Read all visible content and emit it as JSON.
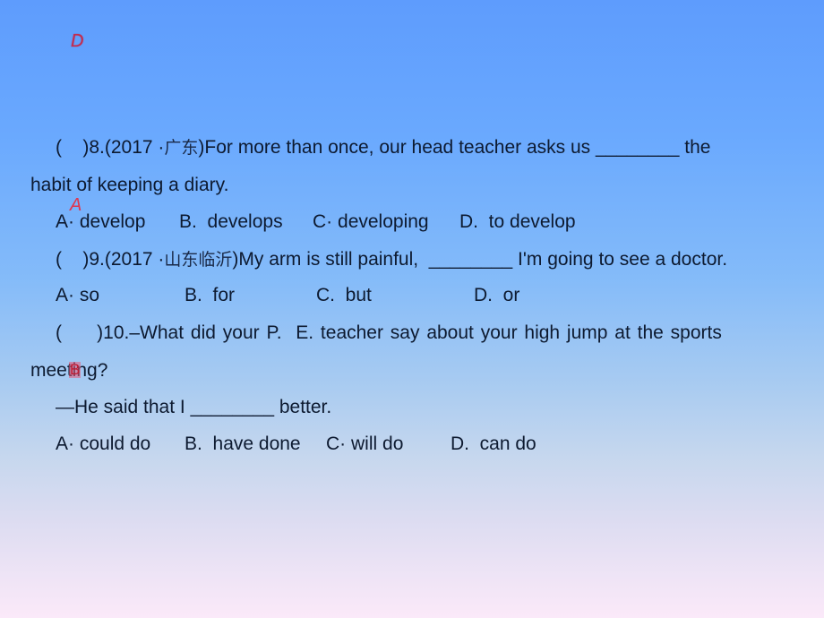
{
  "slide": {
    "answers": {
      "q7": "D",
      "q8": "A",
      "q10": "B"
    },
    "questions": [
      {
        "id": "q8",
        "bracket": "(    )",
        "number": "8.",
        "source_prefix": "(2017 ·",
        "source_region": "广东",
        "source_suffix": ")",
        "stem_line1": "For more than once, our head teacher asks us ________ the",
        "stem_line2": "habit of keeping a diary.",
        "options": [
          {
            "letter": "A·",
            "text": "develop"
          },
          {
            "letter": "B.",
            "text": "develops"
          },
          {
            "letter": "C·",
            "text": "developing"
          },
          {
            "letter": "D.",
            "text": "to develop"
          }
        ]
      },
      {
        "id": "q9",
        "bracket": "(    )",
        "number": "9.",
        "source_prefix": "(2017 ·",
        "source_region": "山东临沂",
        "source_suffix": ")",
        "stem_line1": "My arm is still painful,  ________ I'm going to see a doctor.",
        "options": [
          {
            "letter": "A·",
            "text": "so"
          },
          {
            "letter": "B.",
            "text": "for"
          },
          {
            "letter": "C.",
            "text": "but"
          },
          {
            "letter": "D.",
            "text": "or"
          }
        ]
      },
      {
        "id": "q10",
        "bracket": "(     )",
        "number": "10.",
        "stem_line1": "–What did your P.  E. teacher say about your high jump at the sports",
        "stem_line2": "meeting?",
        "stem_line3": "—He said that I ________ better.",
        "options": [
          {
            "letter": "A·",
            "text": "could do"
          },
          {
            "letter": "B.",
            "text": "have done"
          },
          {
            "letter": "C·",
            "text": "will do"
          },
          {
            "letter": "D.",
            "text": "can do"
          }
        ]
      }
    ]
  }
}
